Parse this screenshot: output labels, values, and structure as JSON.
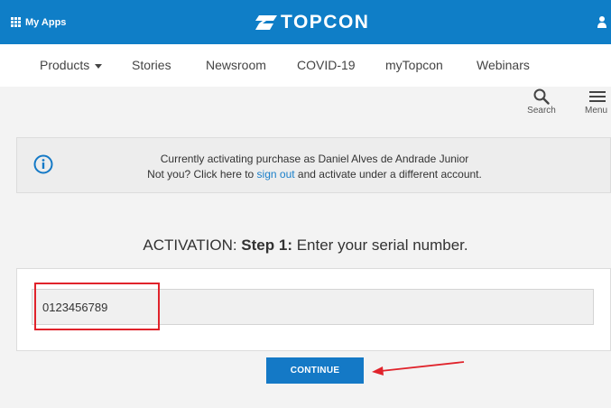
{
  "topbar": {
    "apps_label": "My Apps",
    "logo_text": "TOPCON",
    "bg_color": "#0f7ec7"
  },
  "nav": {
    "items": [
      {
        "label": "Products",
        "has_dropdown": true
      },
      {
        "label": "Stories"
      },
      {
        "label": "Newsroom"
      },
      {
        "label": "COVID-19"
      },
      {
        "label": "myTopcon"
      },
      {
        "label": "Webinars"
      }
    ]
  },
  "tools": {
    "search_label": "Search",
    "menu_label": "Menu",
    "search_icon": "search-icon",
    "menu_icon": "hamburger-icon"
  },
  "info": {
    "icon": "info-icon",
    "line1": "Currently activating purchase as Daniel Alves de Andrade Junior",
    "line2_pre": "Not you? Click here to ",
    "line2_link": "sign out",
    "line2_post": " and activate under a different account."
  },
  "step": {
    "prefix": "ACTIVATION: ",
    "strong": "Step 1:",
    "suffix": " Enter your serial number."
  },
  "serial": {
    "value": "0123456789"
  },
  "continue_label": "CONTINUE",
  "colors": {
    "accent": "#1479c6",
    "highlight": "#e0232b",
    "band": "#f3f3f3"
  }
}
